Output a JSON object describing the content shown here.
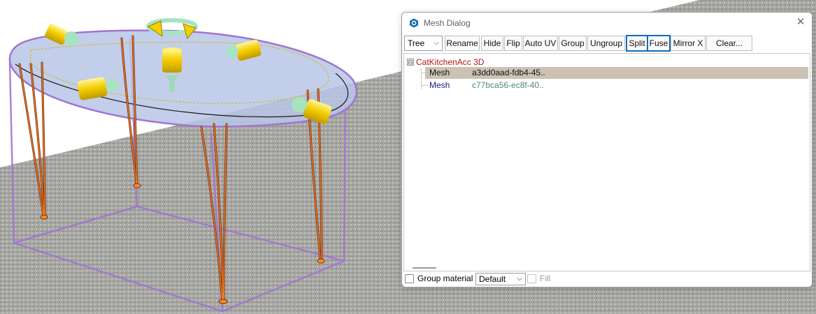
{
  "dialog": {
    "title": "Mesh Dialog",
    "close_glyph": "✕",
    "icon": "hexagon-gear-icon",
    "accent": "#0f6cbd"
  },
  "toolbar": {
    "view_select": {
      "value": "Tree",
      "arrow": "⌵"
    },
    "buttons": [
      {
        "label": "Rename"
      },
      {
        "label": "Hide"
      },
      {
        "label": "Flip"
      },
      {
        "label": "Auto UV"
      },
      {
        "label": "Group"
      },
      {
        "label": "Ungroup"
      },
      {
        "label": "Split",
        "highlighted": true
      },
      {
        "label": "Fuse",
        "highlighted": true
      },
      {
        "label": "Mirror X"
      },
      {
        "label": "Clear..."
      }
    ]
  },
  "tree": {
    "root": {
      "expander": "⊟",
      "label": "CatKitchenAcc 3D"
    },
    "rows": [
      {
        "name": "Mesh",
        "id": "a3dd0aad-fdb4-45..",
        "selected": true
      },
      {
        "name": "Mesh",
        "id": "c77bca56-ec8f-40..",
        "selected": false
      }
    ]
  },
  "footer": {
    "group_material_label": "Group material",
    "material_select": {
      "value": "Default",
      "arrow": "⌵"
    },
    "fill_label": "Fill"
  },
  "colors": {
    "selected_row": "#ccc2b4",
    "root_label": "#b41212",
    "mesh_name": "#1a1a8c",
    "mesh_id": "#4f8a6f",
    "bounding_box": "#9a66c8",
    "gizmo_yellow": "#f5cf00",
    "gizmo_mint": "#a6e3bf"
  }
}
